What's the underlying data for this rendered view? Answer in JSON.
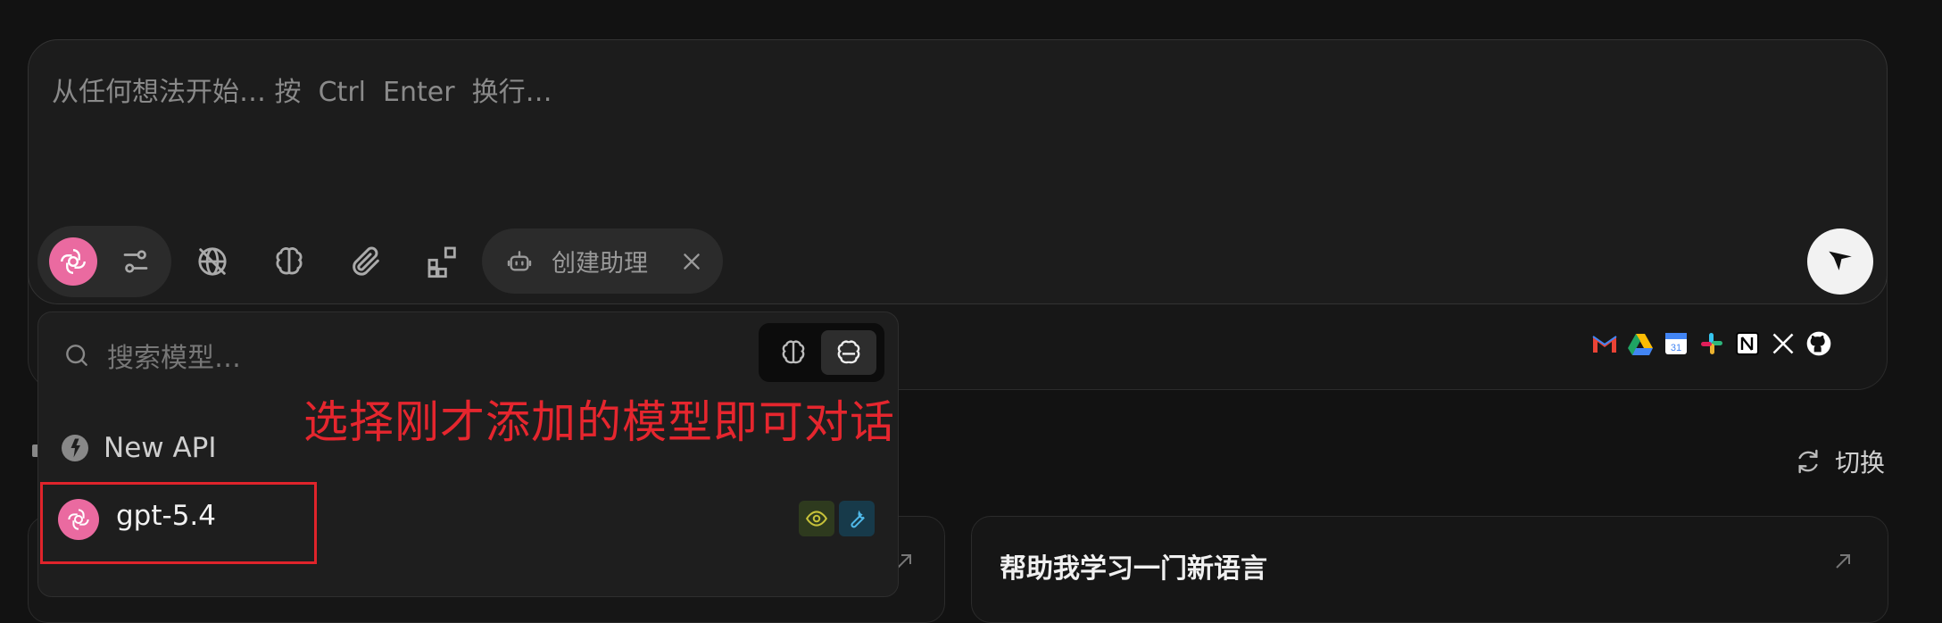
{
  "composer": {
    "placeholder": "从任何想法开始… 按  Ctrl  Enter  换行…",
    "assistant_label": "创建助理"
  },
  "toolbar": {
    "icons": [
      "openai-model-icon",
      "settings-sliders-icon",
      "web-off-icon",
      "brain-icon",
      "paperclip-icon",
      "apps-add-icon",
      "robot-icon",
      "close-icon",
      "send-icon"
    ]
  },
  "integrations": [
    "gmail-icon",
    "google-drive-icon",
    "google-calendar-icon",
    "slack-icon",
    "notion-icon",
    "x-icon",
    "github-icon"
  ],
  "dropdown": {
    "search_placeholder": "搜索模型…",
    "provider": "New API",
    "models": [
      {
        "name": "gpt-5.4",
        "badges": [
          "vision",
          "tools"
        ]
      }
    ]
  },
  "annotation": "选择刚才添加的模型即可对话",
  "switch_label": "切换",
  "cards": [
    {
      "title": ""
    },
    {
      "title": "帮助我学习一门新语言"
    }
  ],
  "colors": {
    "accent_pink": "#ea6aa0",
    "annotation_red": "#e0242b",
    "background": "#121212"
  }
}
